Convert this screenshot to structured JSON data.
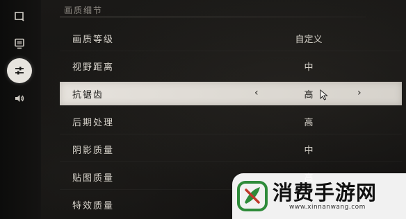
{
  "section": {
    "title": "画质细节"
  },
  "rail": {
    "items": [
      {
        "icon": "display-frame-icon",
        "active": false
      },
      {
        "icon": "monitor-icon",
        "active": false
      },
      {
        "icon": "sliders-icon",
        "active": true
      },
      {
        "icon": "speaker-icon",
        "active": false
      }
    ]
  },
  "settings": [
    {
      "label": "画质等级",
      "value": "自定义"
    },
    {
      "label": "视野距离",
      "value": "中"
    },
    {
      "label": "抗锯齿",
      "value": "高",
      "selected": true,
      "prev": "‹",
      "next": "›"
    },
    {
      "label": "后期处理",
      "value": "高"
    },
    {
      "label": "阴影质量",
      "value": "中"
    },
    {
      "label": "贴图质量",
      "value": "高"
    },
    {
      "label": "特效质量",
      "value": ""
    }
  ],
  "watermark": {
    "title": "消费手游网",
    "url": "www.xinnanwang.com",
    "accent": "#2e8b3a",
    "mark": "#c0392b"
  }
}
